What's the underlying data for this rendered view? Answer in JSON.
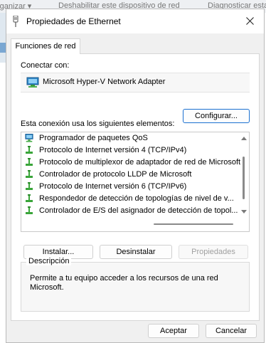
{
  "background_window": {
    "items": [
      "rganizar ▾",
      "Deshabilitar este dispositivo de red",
      "Diagnosticar esta"
    ]
  },
  "dialog": {
    "title": "Propiedades de Ethernet",
    "tabs": [
      {
        "label": "Funciones de red",
        "active": true
      }
    ],
    "connect_using_label": "Conectar con:",
    "adapter_name": "Microsoft Hyper-V Network Adapter",
    "configure_button": "Configurar...",
    "items_label": "Esta conexión usa los siguientes elementos:",
    "items": [
      {
        "label": "Programador de paquetes QoS",
        "checked": true,
        "icon": "network-service-icon"
      },
      {
        "label": "Protocolo de Internet versión 4 (TCP/IPv4)",
        "checked": true,
        "icon": "protocol-icon"
      },
      {
        "label": "Protocolo de multiplexor de adaptador de red de Microsoft",
        "checked": false,
        "icon": "protocol-icon"
      },
      {
        "label": "Controlador de protocolo LLDP de Microsoft",
        "checked": true,
        "icon": "protocol-icon"
      },
      {
        "label": "Protocolo de Internet versión 6 (TCP/IPv6)",
        "checked": true,
        "icon": "protocol-icon"
      },
      {
        "label": "Respondedor de detección de topologías de nivel de v...",
        "checked": true,
        "icon": "protocol-icon"
      },
      {
        "label": "Controlador de E/S del asignador de detección de topol...",
        "checked": true,
        "icon": "protocol-icon"
      }
    ],
    "install_button": "Instalar...",
    "uninstall_button": "Desinstalar",
    "properties_button": "Propiedades",
    "description_legend": "Descripción",
    "description_text": "Permite a tu equipo acceder a los recursos de una red\nMicrosoft.",
    "accept_button": "Aceptar",
    "cancel_button": "Cancelar"
  },
  "colors": {
    "focus_border": "#1a6fcf",
    "checkbox_fill": "#1a6fcf",
    "protocol_icon_green": "#3aa53a"
  }
}
